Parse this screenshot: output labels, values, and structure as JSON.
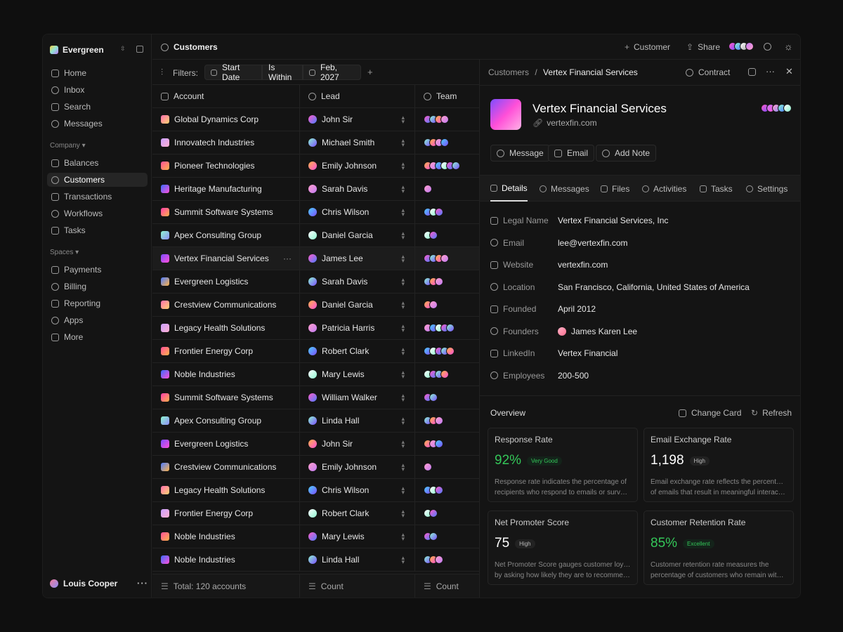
{
  "sidebar": {
    "brand": "Evergreen",
    "nav_top": [
      {
        "label": "Home",
        "icon": "home-icon"
      },
      {
        "label": "Inbox",
        "icon": "inbox-icon"
      },
      {
        "label": "Search",
        "icon": "search-icon"
      },
      {
        "label": "Messages",
        "icon": "messages-icon"
      }
    ],
    "company_label": "Company",
    "nav_company": [
      {
        "label": "Balances",
        "icon": "balances-icon"
      },
      {
        "label": "Customers",
        "icon": "customers-icon"
      },
      {
        "label": "Transactions",
        "icon": "transactions-icon"
      },
      {
        "label": "Workflows",
        "icon": "workflows-icon"
      },
      {
        "label": "Tasks",
        "icon": "tasks-icon"
      }
    ],
    "spaces_label": "Spaces",
    "nav_spaces": [
      {
        "label": "Payments",
        "icon": "payments-icon"
      },
      {
        "label": "Billing",
        "icon": "billing-icon"
      },
      {
        "label": "Reporting",
        "icon": "reporting-icon"
      },
      {
        "label": "Apps",
        "icon": "apps-icon"
      },
      {
        "label": "More",
        "icon": "more-icon"
      }
    ],
    "user": "Louis Cooper"
  },
  "topbar": {
    "title": "Customers",
    "customer_btn": "Customer",
    "share_btn": "Share"
  },
  "filters": {
    "label": "Filters:",
    "field": "Start Date",
    "operator": "Is Within",
    "value": "Feb, 2027"
  },
  "table": {
    "headers": {
      "account": "Account",
      "lead": "Lead",
      "team": "Team"
    },
    "rows": [
      {
        "account": "Global Dynamics Corp",
        "lead": "John Sir",
        "team": 4
      },
      {
        "account": "Innovatech Industries",
        "lead": "Michael Smith",
        "team": 4
      },
      {
        "account": "Pioneer Technologies",
        "lead": "Emily Johnson",
        "team": 6
      },
      {
        "account": "Heritage Manufacturing",
        "lead": "Sarah Davis",
        "team": 1
      },
      {
        "account": "Summit Software Systems",
        "lead": "Chris Wilson",
        "team": 3
      },
      {
        "account": "Apex Consulting Group",
        "lead": "Daniel Garcia",
        "team": 2
      },
      {
        "account": "Vertex Financial Services",
        "lead": "James Lee",
        "team": 4
      },
      {
        "account": "Evergreen Logistics",
        "lead": "Sarah Davis",
        "team": 3
      },
      {
        "account": "Crestview Communications",
        "lead": "Daniel Garcia",
        "team": 2
      },
      {
        "account": "Legacy Health Solutions",
        "lead": "Patricia Harris",
        "team": 5
      },
      {
        "account": "Frontier Energy Corp",
        "lead": "Robert Clark",
        "team": 5
      },
      {
        "account": "Noble Industries",
        "lead": "Mary Lewis",
        "team": 4
      },
      {
        "account": "Summit Software Systems",
        "lead": "William Walker",
        "team": 2
      },
      {
        "account": "Apex Consulting Group",
        "lead": "Linda Hall",
        "team": 3
      },
      {
        "account": "Evergreen Logistics",
        "lead": "John Sir",
        "team": 3
      },
      {
        "account": "Crestview Communications",
        "lead": "Emily Johnson",
        "team": 1
      },
      {
        "account": "Legacy Health Solutions",
        "lead": "Chris Wilson",
        "team": 3
      },
      {
        "account": "Frontier Energy Corp",
        "lead": "Robert Clark",
        "team": 2
      },
      {
        "account": "Noble Industries",
        "lead": "Mary Lewis",
        "team": 2
      },
      {
        "account": "Noble Industries",
        "lead": "Linda Hall",
        "team": 3
      }
    ],
    "footer": {
      "total": "Total: 120 accounts",
      "count1": "Count",
      "count2": "Count"
    }
  },
  "panel": {
    "crumb_root": "Customers",
    "crumb_sep": "/",
    "crumb_current": "Vertex Financial Services",
    "contract_btn": "Contract",
    "name": "Vertex Financial Services",
    "website": "vertexfin.com",
    "actions": {
      "message": "Message",
      "email": "Email",
      "note": "Add Note"
    },
    "tabs": [
      "Details",
      "Messages",
      "Files",
      "Activities",
      "Tasks",
      "Settings"
    ],
    "fields": [
      {
        "label": "Legal Name",
        "value": "Vertex Financial Services, Inc"
      },
      {
        "label": "Email",
        "value": "lee@vertexfin.com"
      },
      {
        "label": "Website",
        "value": "vertexfin.com"
      },
      {
        "label": "Location",
        "value": "San Francisco, California, United States of America"
      },
      {
        "label": "Founded",
        "value": "April 2012"
      },
      {
        "label": "Founders",
        "value": "James Karen Lee"
      },
      {
        "label": "LinkedIn",
        "value": "Vertex Financial"
      },
      {
        "label": "Employees",
        "value": "200-500"
      }
    ],
    "overview": {
      "title": "Overview",
      "change_card": "Change Card",
      "refresh": "Refresh"
    },
    "cards": [
      {
        "title": "Response Rate",
        "value": "92%",
        "badge": "Very Good",
        "desc1": "Response rate indicates the percentage of",
        "desc2": "recipients who respond to emails or surveys.",
        "green": true
      },
      {
        "title": "Email Exchange Rate",
        "value": "1,198",
        "badge": "High",
        "desc1": "Email exchange rate reflects the percentage",
        "desc2": "of emails that result in meaningful interactio...",
        "green": false
      },
      {
        "title": "Net Promoter Score",
        "value": "75",
        "badge": "High",
        "desc1": "Net Promoter Score gauges customer loyalty",
        "desc2": "by asking how likely they are to recommend...",
        "green": false
      },
      {
        "title": "Customer Retention Rate",
        "value": "85%",
        "badge": "Excellent",
        "desc1": "Customer retention rate measures the",
        "desc2": "percentage of customers who remain with t...",
        "green": true
      }
    ]
  }
}
